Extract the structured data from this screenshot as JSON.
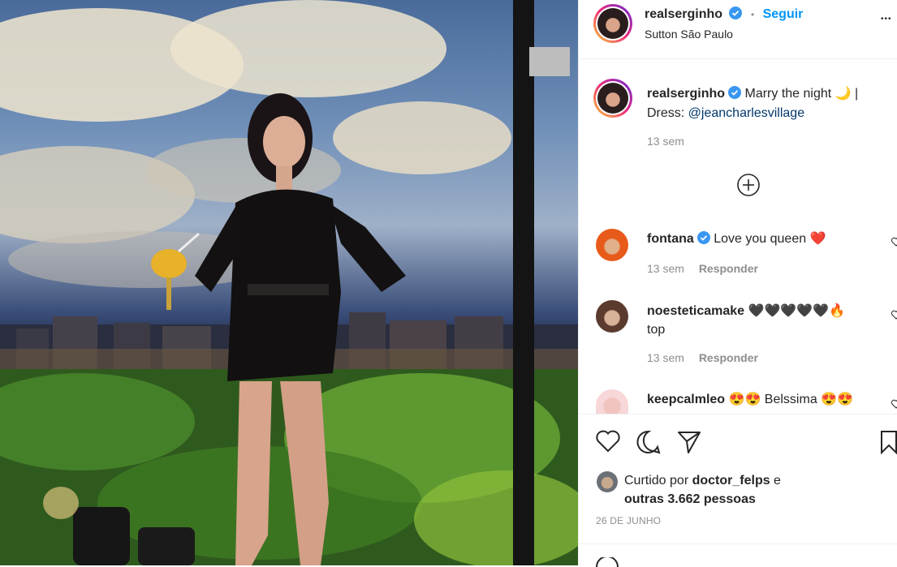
{
  "post": {
    "username": "realserginho",
    "follow_label": "Seguir",
    "separator": "•",
    "location": "Sutton São Paulo",
    "more": "•••"
  },
  "caption": {
    "username": "realserginho",
    "text_line1": "Marry the night 🌙 |",
    "text_line2_prefix": "Dress: ",
    "mention": "@jeancharlesvillage",
    "time": "13 sem"
  },
  "comments": [
    {
      "username": "fontana",
      "text": "Love you queen ❤️",
      "time": "13 sem",
      "reply": "Responder"
    },
    {
      "username": "noesteticamake",
      "text": "🖤🖤🖤🖤🖤🔥",
      "text2": "top",
      "time": "13 sem",
      "reply": "Responder"
    },
    {
      "username": "keepcalmleo",
      "text": "😍😍 Belssima 😍😍"
    }
  ],
  "likes": {
    "prefix": "Curtido por ",
    "user": "doctor_felps",
    "suffix": " e",
    "others": "outras 3.662 pessoas"
  },
  "date": "26 DE JUNHO",
  "colors": {
    "link": "#0095f6",
    "verified": "#3897f0",
    "muted": "#8e8e8e",
    "text": "#262626"
  },
  "icons": [
    "heart-icon",
    "comment-icon",
    "share-icon",
    "bookmark-icon",
    "add-circle-icon",
    "verified-icon",
    "more-icon"
  ]
}
